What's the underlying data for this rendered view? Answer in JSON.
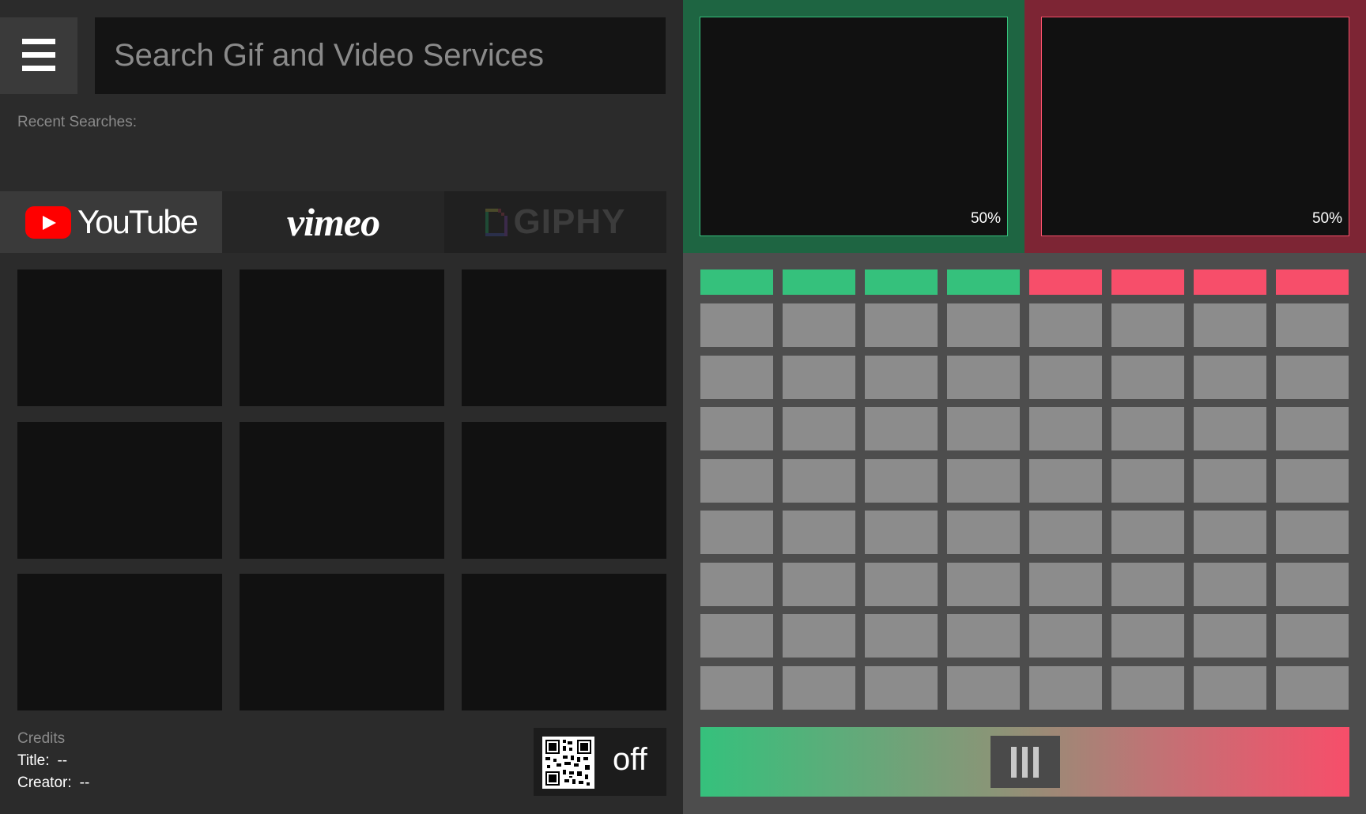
{
  "search": {
    "placeholder": "Search Gif and Video Services",
    "value": ""
  },
  "recent_searches": {
    "label": "Recent Searches:"
  },
  "services": [
    {
      "name": "YouTube",
      "active": true
    },
    {
      "name": "vimeo",
      "active": false
    },
    {
      "name": "GIPHY",
      "active": false
    }
  ],
  "results": {
    "count": 9
  },
  "credits": {
    "heading": "Credits",
    "title_label": "Title:",
    "title_value": "--",
    "creator_label": "Creator:",
    "creator_value": "--"
  },
  "qr": {
    "state": "off"
  },
  "decks": [
    {
      "id": "a",
      "color": "#1e6542",
      "accent": "#35c17c",
      "volume": "50%"
    },
    {
      "id": "b",
      "color": "#7d2534",
      "accent": "#f6506a",
      "volume": "50%"
    }
  ],
  "pads": {
    "columns": 8,
    "rows": 8,
    "header_colors": [
      "#35c17c",
      "#35c17c",
      "#35c17c",
      "#35c17c",
      "#f74e6a",
      "#f74e6a",
      "#f74e6a",
      "#f74e6a"
    ],
    "pad_color": "#8c8c8c"
  },
  "crossfader": {
    "position": 0.5,
    "left_color": "#35c17c",
    "right_color": "#f74e6a"
  },
  "icons": {
    "menu": "hamburger-icon",
    "qr": "qr-code-icon",
    "grip": "grip-icon"
  }
}
